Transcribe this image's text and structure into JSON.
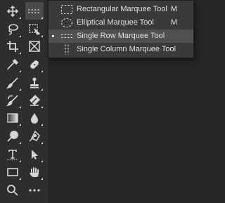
{
  "toolbar": {
    "tools": [
      {
        "name": "move-tool",
        "icon": "move-icon"
      },
      {
        "name": "marquee-tool",
        "icon": "single-row-marquee-icon",
        "active": true
      },
      {
        "name": "lasso-tool",
        "icon": "lasso-icon"
      },
      {
        "name": "quick-selection-tool",
        "icon": "quick-selection-icon"
      },
      {
        "name": "crop-tool",
        "icon": "crop-icon"
      },
      {
        "name": "frame-tool",
        "icon": "frame-icon"
      },
      {
        "name": "eyedropper-tool",
        "icon": "eyedropper-icon"
      },
      {
        "name": "spot-healing-brush-tool",
        "icon": "spot-healing-icon"
      },
      {
        "name": "brush-tool",
        "icon": "brush-icon"
      },
      {
        "name": "clone-stamp-tool",
        "icon": "clone-stamp-icon"
      },
      {
        "name": "history-brush-tool",
        "icon": "history-brush-icon"
      },
      {
        "name": "eraser-tool",
        "icon": "eraser-icon"
      },
      {
        "name": "gradient-tool",
        "icon": "gradient-icon"
      },
      {
        "name": "blur-tool",
        "icon": "blur-icon"
      },
      {
        "name": "dodge-tool",
        "icon": "dodge-icon"
      },
      {
        "name": "pen-tool",
        "icon": "pen-icon"
      },
      {
        "name": "type-tool",
        "icon": "type-icon"
      },
      {
        "name": "path-selection-tool",
        "icon": "path-selection-icon"
      },
      {
        "name": "rectangle-tool",
        "icon": "rectangle-icon"
      },
      {
        "name": "hand-tool",
        "icon": "hand-icon"
      },
      {
        "name": "zoom-tool",
        "icon": "zoom-icon"
      },
      {
        "name": "edit-toolbar-button",
        "icon": "more-icon"
      }
    ]
  },
  "flyout": {
    "items": [
      {
        "label": "Rectangular Marquee Tool",
        "shortcut": "M",
        "icon": "rectangular-marquee-icon",
        "selected": false
      },
      {
        "label": "Elliptical Marquee Tool",
        "shortcut": "M",
        "icon": "elliptical-marquee-icon",
        "selected": false
      },
      {
        "label": "Single Row Marquee Tool",
        "shortcut": "",
        "icon": "single-row-marquee-icon",
        "selected": true
      },
      {
        "label": "Single Column Marquee Tool",
        "shortcut": "",
        "icon": "single-column-marquee-icon",
        "selected": false
      }
    ]
  },
  "colors": {
    "toolbar_bg": "#2e2e2e",
    "flyout_bg": "#3a3a3a",
    "selected_bg": "#505050",
    "icon": "#d6d6d6",
    "text": "#e0e0e0"
  }
}
